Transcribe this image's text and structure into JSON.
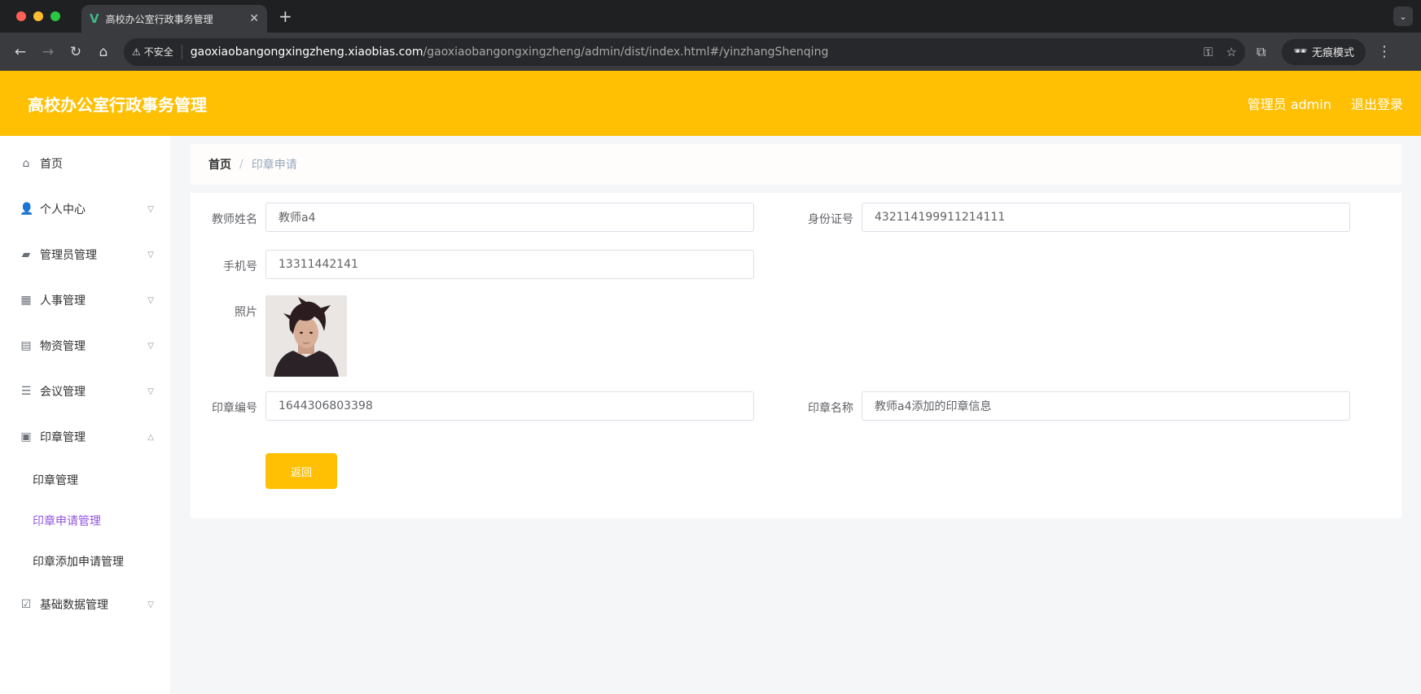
{
  "browser": {
    "tab_title": "高校办公室行政事务管理",
    "insecure_label": "不安全",
    "url_host": "gaoxiaobangongxingzheng.xiaobias.com",
    "url_path": "/gaoxiaobangongxingzheng/admin/dist/index.html#/yinzhangShenqing",
    "incognito_label": "无痕模式"
  },
  "header": {
    "title": "高校办公室行政事务管理",
    "user_label": "管理员 admin",
    "logout_label": "退出登录",
    "brand_color": "#ffc004"
  },
  "sidebar": {
    "items": [
      {
        "label": "首页",
        "icon": "home-icon"
      },
      {
        "label": "个人中心",
        "icon": "user-icon"
      },
      {
        "label": "管理员管理",
        "icon": "ticket-icon"
      },
      {
        "label": "人事管理",
        "icon": "grid-icon"
      },
      {
        "label": "物资管理",
        "icon": "chat-icon"
      },
      {
        "label": "会议管理",
        "icon": "list-icon"
      },
      {
        "label": "印章管理",
        "icon": "stamp-icon"
      },
      {
        "label": "基础数据管理",
        "icon": "clipboard-icon"
      }
    ],
    "seal_submenu": [
      {
        "label": "印章管理"
      },
      {
        "label": "印章申请管理"
      },
      {
        "label": "印章添加申请管理"
      }
    ],
    "active_color": "#9254de"
  },
  "breadcrumb": {
    "home": "首页",
    "current": "印章申请"
  },
  "form": {
    "teacher_name_label": "教师姓名",
    "teacher_name_value": "教师a4",
    "id_card_label": "身份证号",
    "id_card_value": "432114199911214111",
    "phone_label": "手机号",
    "phone_value": "13311442141",
    "photo_label": "照片",
    "seal_no_label": "印章编号",
    "seal_no_value": "1644306803398",
    "seal_name_label": "印章名称",
    "seal_name_value": "教师a4添加的印章信息",
    "back_label": "返回"
  }
}
